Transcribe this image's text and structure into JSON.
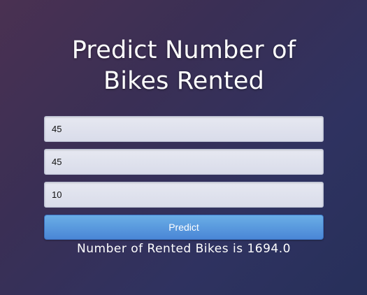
{
  "page": {
    "title": "Predict Number of Bikes Rented"
  },
  "form": {
    "fields": [
      {
        "value": "45"
      },
      {
        "value": "45"
      },
      {
        "value": "10"
      }
    ],
    "submit_label": "Predict"
  },
  "result": {
    "text": "Number of Rented Bikes is 1694.0"
  }
}
